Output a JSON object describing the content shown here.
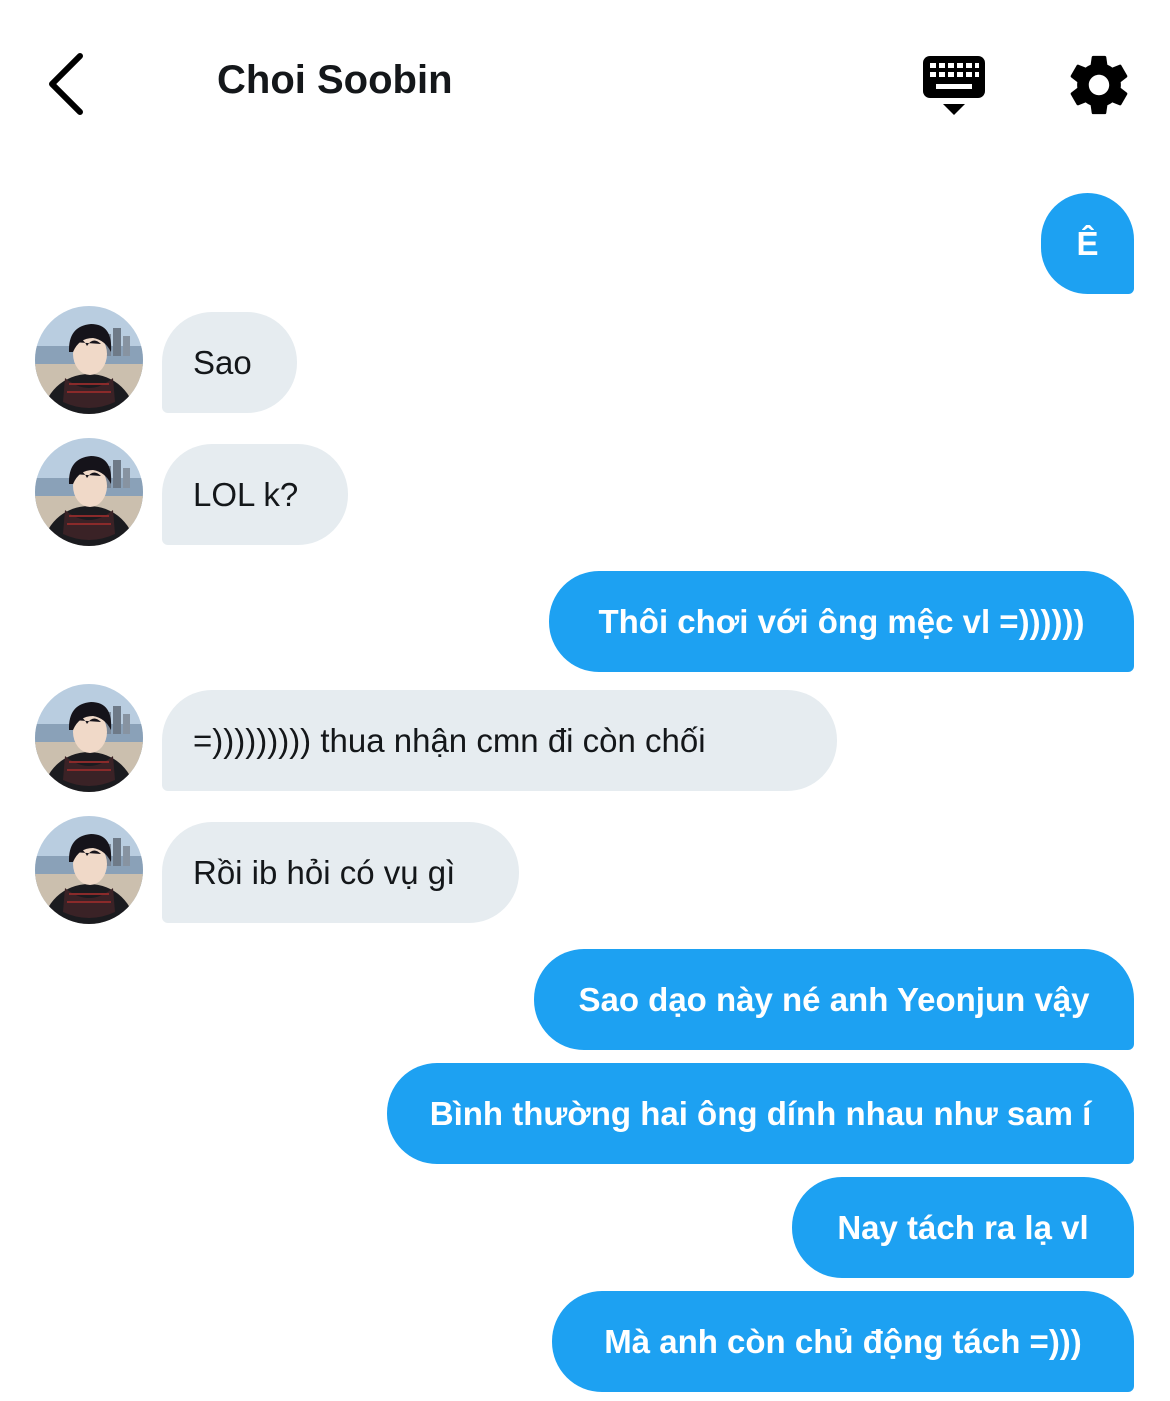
{
  "header": {
    "title": "Choi Soobin"
  },
  "icons": {
    "back": "chevron-left-icon",
    "keyboard": "keyboard-icon",
    "settings": "gear-icon"
  },
  "colors": {
    "outgoing_bubble": "#1da1f2",
    "incoming_bubble": "#e6ecf0",
    "text": "#14171a"
  },
  "messages": [
    {
      "direction": "out",
      "text": "Ê"
    },
    {
      "direction": "in",
      "text": "Sao"
    },
    {
      "direction": "in",
      "text": "LOL k?"
    },
    {
      "direction": "out",
      "text": "Thôi chơi với ông mệc vl =))))))"
    },
    {
      "direction": "in",
      "text": "=))))))))) thua nhận cmn đi còn chối"
    },
    {
      "direction": "in",
      "text": "Rồi ib hỏi có vụ gì"
    },
    {
      "direction": "out",
      "text": "Sao dạo này né anh Yeonjun vậy"
    },
    {
      "direction": "out",
      "text": "Bình thường hai ông dính nhau như sam í"
    },
    {
      "direction": "out",
      "text": "Nay tách ra lạ vl"
    },
    {
      "direction": "out",
      "text": "Mà anh còn chủ động tách =)))"
    }
  ]
}
